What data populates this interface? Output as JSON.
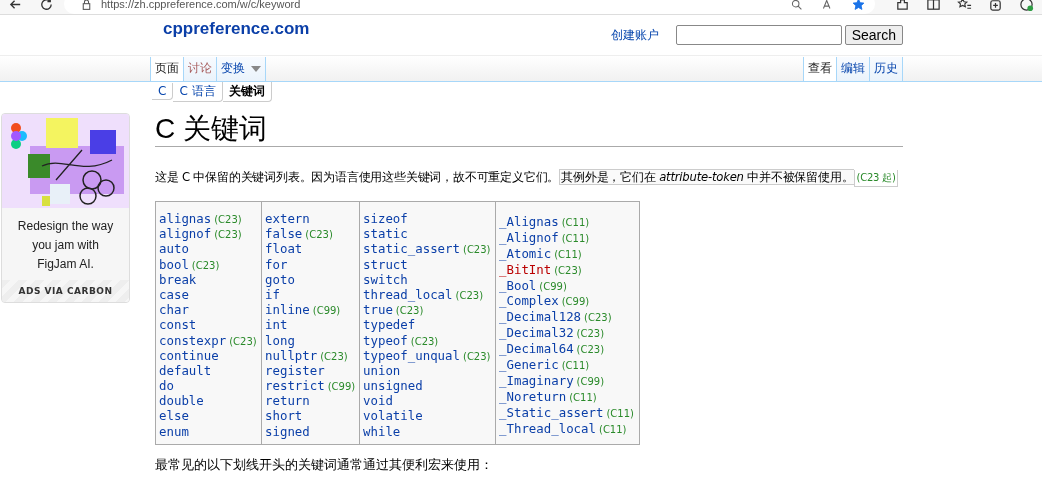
{
  "browser": {
    "url": "https://zh.cppreference.com/w/c/keyword",
    "favorite": true
  },
  "header": {
    "logo": "cppreference.com",
    "account_link": "创建账户",
    "search_button": "Search"
  },
  "tabs_left": [
    {
      "label": "页面",
      "selected": true,
      "missing": false,
      "kind": "tab"
    },
    {
      "label": "讨论",
      "selected": false,
      "missing": true,
      "kind": "tab"
    },
    {
      "label": "变换",
      "selected": false,
      "missing": false,
      "kind": "dropdown"
    }
  ],
  "tabs_right": [
    {
      "label": "查看",
      "selected": true,
      "missing": false
    },
    {
      "label": "编辑",
      "selected": false,
      "missing": false
    },
    {
      "label": "历史",
      "selected": false,
      "missing": false
    }
  ],
  "breadcrumb": [
    {
      "label": "C",
      "current": false
    },
    {
      "label": "C 语言",
      "current": false
    },
    {
      "label": "关键词",
      "current": true
    }
  ],
  "ad": {
    "text": "Redesign the way you jam with FigJam AI.",
    "footer": "ADS VIA CARBON"
  },
  "title": "C 关键词",
  "intro": {
    "text": "这是 C 中保留的关键词列表。因为语言使用这些关键词，故不可重定义它们。",
    "note": "其例外是，它们在 *attribute-token* 中并不被保留使用。",
    "note_version": "(C23 起)"
  },
  "keyword_columns": [
    [
      {
        "name": "alignas",
        "version": "(C23)",
        "missing": false
      },
      {
        "name": "alignof",
        "version": "(C23)",
        "missing": false
      },
      {
        "name": "auto",
        "missing": false
      },
      {
        "name": "bool",
        "version": "(C23)",
        "missing": false
      },
      {
        "name": "break",
        "missing": false
      },
      {
        "name": "case",
        "missing": false
      },
      {
        "name": "char",
        "missing": false
      },
      {
        "name": "const",
        "missing": false
      },
      {
        "name": "constexpr",
        "version": "(C23)",
        "missing": false
      },
      {
        "name": "continue",
        "missing": false
      },
      {
        "name": "default",
        "missing": false
      },
      {
        "name": "do",
        "missing": false
      },
      {
        "name": "double",
        "missing": false
      },
      {
        "name": "else",
        "missing": false
      },
      {
        "name": "enum",
        "missing": false
      }
    ],
    [
      {
        "name": "extern",
        "missing": false
      },
      {
        "name": "false",
        "version": "(C23)",
        "missing": false
      },
      {
        "name": "float",
        "missing": false
      },
      {
        "name": "for",
        "missing": false
      },
      {
        "name": "goto",
        "missing": false
      },
      {
        "name": "if",
        "missing": false
      },
      {
        "name": "inline",
        "version": "(C99)",
        "missing": false
      },
      {
        "name": "int",
        "missing": false
      },
      {
        "name": "long",
        "missing": false
      },
      {
        "name": "nullptr",
        "version": "(C23)",
        "missing": false
      },
      {
        "name": "register",
        "missing": false
      },
      {
        "name": "restrict",
        "version": "(C99)",
        "missing": false
      },
      {
        "name": "return",
        "missing": false
      },
      {
        "name": "short",
        "missing": false
      },
      {
        "name": "signed",
        "missing": false
      }
    ],
    [
      {
        "name": "sizeof",
        "missing": false
      },
      {
        "name": "static",
        "missing": false
      },
      {
        "name": "static_assert",
        "version": "(C23)",
        "missing": false
      },
      {
        "name": "struct",
        "missing": false
      },
      {
        "name": "switch",
        "missing": false
      },
      {
        "name": "thread_local",
        "version": "(C23)",
        "missing": false
      },
      {
        "name": "true",
        "version": "(C23)",
        "missing": false
      },
      {
        "name": "typedef",
        "missing": false
      },
      {
        "name": "typeof",
        "version": "(C23)",
        "missing": false
      },
      {
        "name": "typeof_unqual",
        "version": "(C23)",
        "missing": false
      },
      {
        "name": "union",
        "missing": false
      },
      {
        "name": "unsigned",
        "missing": false
      },
      {
        "name": "void",
        "missing": false
      },
      {
        "name": "volatile",
        "missing": false
      },
      {
        "name": "while",
        "missing": false
      }
    ],
    [
      {
        "name": "_Alignas",
        "version": "(C11)",
        "missing": false
      },
      {
        "name": "_Alignof",
        "version": "(C11)",
        "missing": false
      },
      {
        "name": "_Atomic",
        "version": "(C11)",
        "missing": false
      },
      {
        "name": "_BitInt",
        "version": "(C23)",
        "missing": true
      },
      {
        "name": "_Bool",
        "version": "(C99)",
        "missing": false
      },
      {
        "name": "_Complex",
        "version": "(C99)",
        "missing": false
      },
      {
        "name": "_Decimal128",
        "version": "(C23)",
        "missing": false
      },
      {
        "name": "_Decimal32",
        "version": "(C23)",
        "missing": false
      },
      {
        "name": "_Decimal64",
        "version": "(C23)",
        "missing": false
      },
      {
        "name": "_Generic",
        "version": "(C11)",
        "missing": false
      },
      {
        "name": "_Imaginary",
        "version": "(C99)",
        "missing": false
      },
      {
        "name": "_Noreturn",
        "version": "(C11)",
        "missing": false
      },
      {
        "name": "_Static_assert",
        "version": "(C11)",
        "missing": false
      },
      {
        "name": "_Thread_local",
        "version": "(C11)",
        "missing": false
      }
    ]
  ],
  "footer_text": "最常见的以下划线开头的关键词通常通过其便利宏来使用："
}
